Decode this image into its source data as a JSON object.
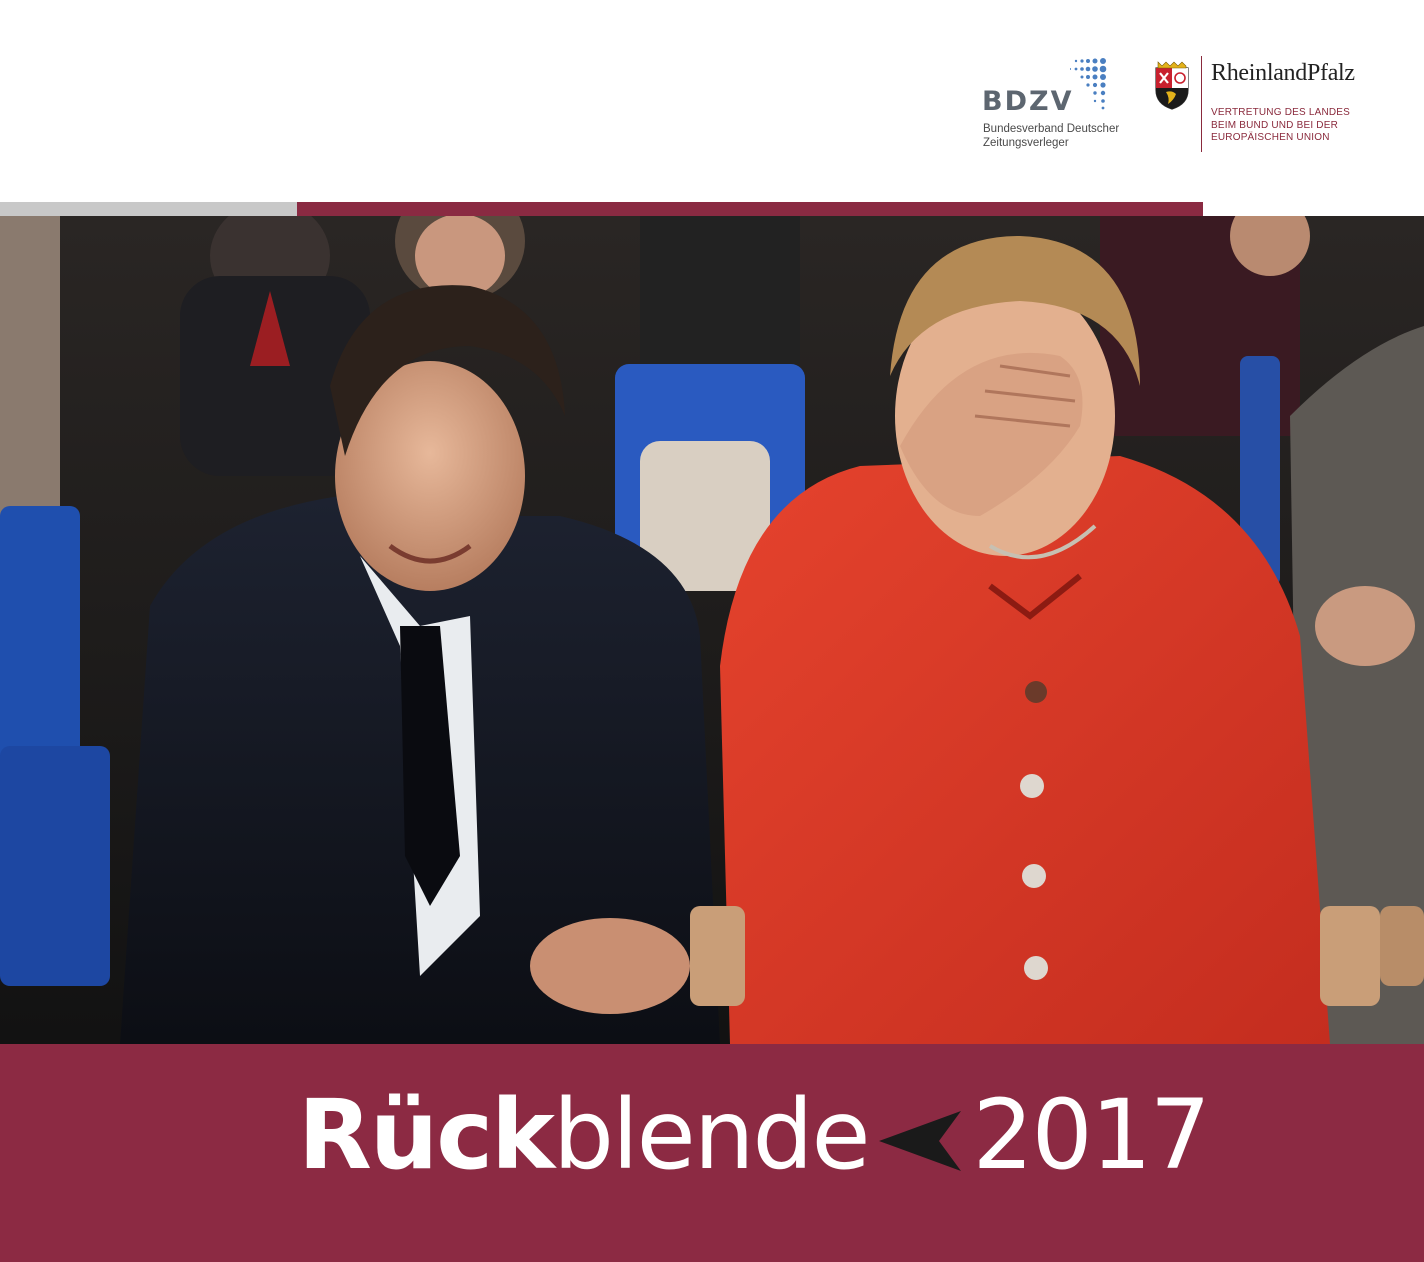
{
  "header": {
    "bdzv": {
      "name": "BDZV",
      "subtitle_line1": "Bundesverband Deutscher",
      "subtitle_line2": "Zeitungsverleger",
      "color": "#5d6670",
      "dots_color": "#4a7fc1"
    },
    "rlp": {
      "name": "RheinlandPfalz",
      "subtitle_line1": "VERTRETUNG DES LANDES",
      "subtitle_line2": "BEIM BUND UND BEI DER",
      "subtitle_line3": "EUROPÄISCHEN UNION",
      "accent": "#8a2a3c"
    }
  },
  "bars": {
    "left_color": "#c8c8c8",
    "right_color": "#8a2a42"
  },
  "cover": {
    "title_bold": "Rück",
    "title_light": "blende",
    "year": "2017",
    "band_color": "#8c2a43",
    "arrow_icon": "left-pointer-icon"
  }
}
